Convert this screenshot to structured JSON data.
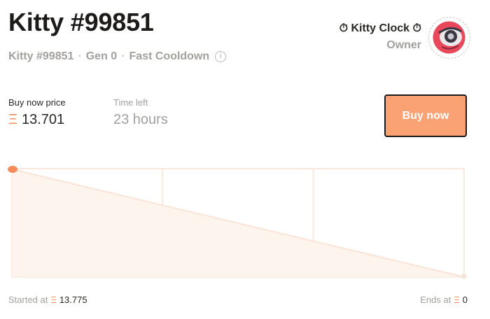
{
  "kitty": {
    "title": "Kitty #99851",
    "subtitle_name": "Kitty #99851",
    "generation": "Gen 0",
    "cooldown": "Fast Cooldown",
    "info_icon": "i"
  },
  "owner": {
    "name": "⏱ Kitty Clock ⏱",
    "label": "Owner",
    "avatar_icon": "kitty-avatar-icon"
  },
  "sale": {
    "price_label": "Buy now price",
    "currency_symbol": "Ξ",
    "price": "13.701",
    "time_label": "Time left",
    "time_left": "23 hours",
    "buy_label": "Buy now"
  },
  "chart_data": {
    "type": "line",
    "title": "",
    "xlabel": "",
    "ylabel": "",
    "x": [
      0,
      1
    ],
    "series": [
      {
        "values": [
          13.775,
          0
        ]
      }
    ],
    "current_position": 0,
    "ylim": [
      0,
      13.775
    ],
    "grid": true
  },
  "chart_labels": {
    "started_label": "Started at",
    "started_value": "13.775",
    "ends_label": "Ends at",
    "ends_value": "0"
  },
  "colors": {
    "accent": "#f78c5a",
    "button": "#fba274",
    "muted": "#a3a19e"
  }
}
